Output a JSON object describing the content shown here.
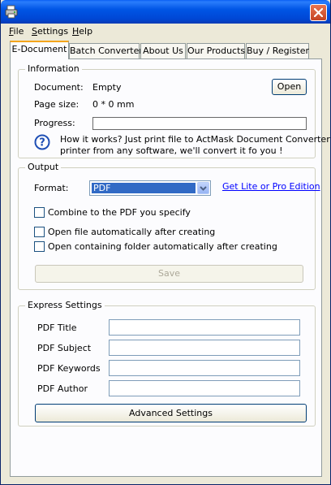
{
  "menu": [
    {
      "label_u": "F",
      "label_rest": "ile"
    },
    {
      "label_u": "S",
      "label_rest": "ettings"
    },
    {
      "label_u": "H",
      "label_rest": "elp"
    }
  ],
  "tabs": [
    "E-Document",
    "Batch Converter",
    "About Us",
    "Our Products",
    "Buy / Register"
  ],
  "information": {
    "group_label": "Information",
    "document_label": "Document:",
    "document_value": "Empty",
    "page_size_label": "Page size:",
    "page_size_value": "0 * 0 mm",
    "progress_label": "Progress:",
    "progress": 0,
    "open_button": "Open",
    "help_line1": "How it works? Just print file to ActMask Document Converter",
    "help_line2": "printer from any software, we'll convert it fo you !"
  },
  "output": {
    "group_label": "Output",
    "format_label": "Format:",
    "format_value": "PDF",
    "edition_link": "Get Lite or Pro Edition",
    "combine_label": "Combine to the PDF you specify",
    "open_file_label": "Open file automatically after creating",
    "open_folder_label": "Open containing folder automatically after creating",
    "save_button": "Save"
  },
  "express": {
    "group_label": "Express Settings",
    "title_label": "PDF Title",
    "subject_label": "PDF Subject",
    "keywords_label": "PDF Keywords",
    "author_label": "PDF Author",
    "title_value": "",
    "subject_value": "",
    "keywords_value": "",
    "author_value": "",
    "advanced_button": "Advanced Settings"
  },
  "colors": {
    "titlebar": "#0055e5",
    "window_bg": "#ece9d8",
    "panel_bg": "#fcfcfe",
    "selection": "#316ac5",
    "link": "#0000ff",
    "tab_highlight": "#f4a51c"
  },
  "icons": {
    "app": "printer-icon",
    "close": "close-icon",
    "help": "question-icon",
    "dropdown": "chevron-down-icon"
  }
}
